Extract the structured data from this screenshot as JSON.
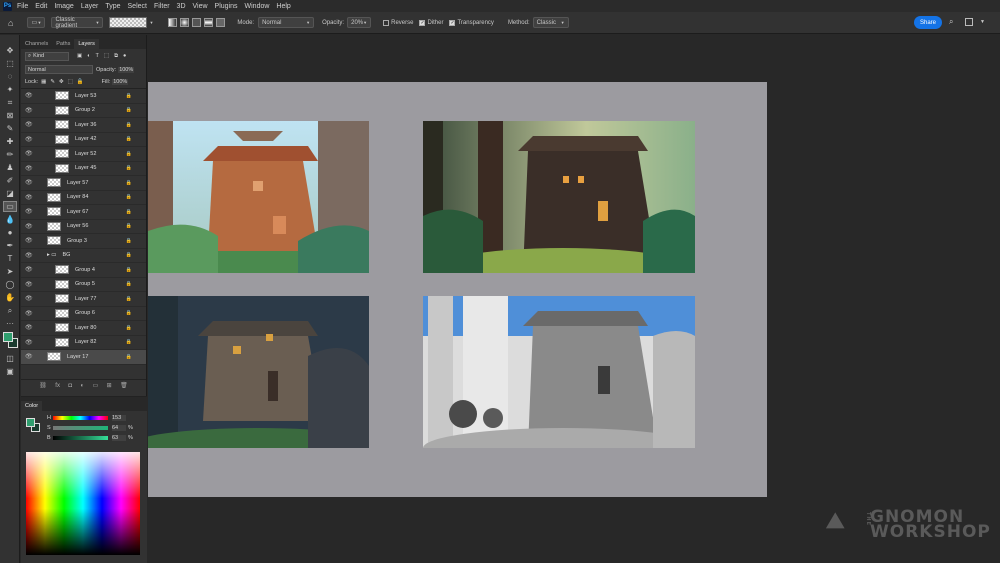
{
  "menubar": {
    "logo": "Ps",
    "items": [
      "File",
      "Edit",
      "Image",
      "Layer",
      "Type",
      "Select",
      "Filter",
      "3D",
      "View",
      "Plugins",
      "Window",
      "Help"
    ]
  },
  "options": {
    "preset": "Classic gradient",
    "mode_label": "Mode:",
    "mode_value": "Normal",
    "opacity_label": "Opacity:",
    "opacity_value": "20%",
    "reverse": "Reverse",
    "dither": "Dither",
    "transparency": "Transparency",
    "method_label": "Method:",
    "method_value": "Classic",
    "share": "Share"
  },
  "layers_panel": {
    "tabs": [
      "Channels",
      "Paths",
      "Layers"
    ],
    "kind": "Kind",
    "blend": "Normal",
    "opacity_label": "Opacity:",
    "opacity_value": "100%",
    "lock_label": "Lock:",
    "fill_label": "Fill:",
    "fill_value": "100%",
    "layers": [
      {
        "name": "Layer 53",
        "indent": 2
      },
      {
        "name": "Group 2",
        "indent": 2
      },
      {
        "name": "Layer 36",
        "indent": 2
      },
      {
        "name": "Layer 42",
        "indent": 2
      },
      {
        "name": "Layer 52",
        "indent": 2
      },
      {
        "name": "Layer 45",
        "indent": 2
      },
      {
        "name": "Layer 57",
        "indent": 1
      },
      {
        "name": "Layer 84",
        "indent": 1
      },
      {
        "name": "Layer 67",
        "indent": 1
      },
      {
        "name": "Layer 56",
        "indent": 1
      },
      {
        "name": "Group 3",
        "indent": 1
      },
      {
        "name": "BG",
        "indent": 1
      },
      {
        "name": "Group 4",
        "indent": 2
      },
      {
        "name": "Group 5",
        "indent": 2
      },
      {
        "name": "Layer 77",
        "indent": 2
      },
      {
        "name": "Group 6",
        "indent": 2
      },
      {
        "name": "Layer 80",
        "indent": 2
      },
      {
        "name": "Layer 82",
        "indent": 2
      },
      {
        "name": "Layer 17",
        "indent": 1
      }
    ]
  },
  "color_panel": {
    "title": "Color",
    "h_label": "H",
    "h_value": "153",
    "s_label": "S",
    "s_value": "64",
    "b_label": "B",
    "b_value": "63",
    "unit": "%",
    "foreground": "#2f9e6e"
  },
  "watermark": {
    "line1": "GNOMON",
    "line2": "WORKSHOP",
    "prefix": "THE"
  }
}
